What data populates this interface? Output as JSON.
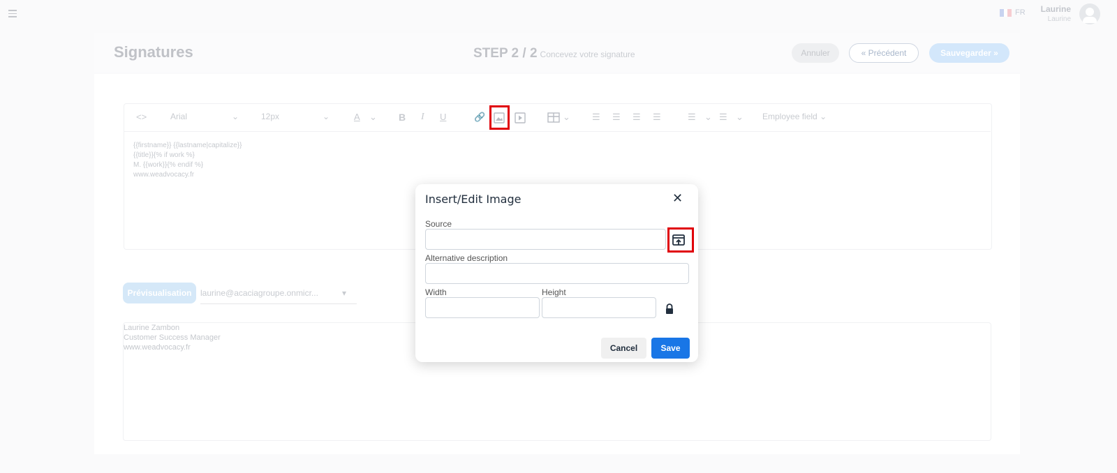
{
  "topbar": {
    "lang": "FR",
    "user_name": "Laurine",
    "user_sub": "Laurine"
  },
  "page": {
    "title": "Signatures",
    "step": "STEP 2 / 2",
    "step_sub": "Concevez votre signature",
    "btn_cancel": "Annuler",
    "btn_prev": "Précédent",
    "btn_save": "Sauvegarder"
  },
  "toolbar": {
    "font": "Arial",
    "size": "12px",
    "employee_field": "Employee field"
  },
  "editor_lines": [
    "{{firstname}} {{lastname|capitalize}}",
    "{{title}}{% if work %}",
    "M. {{work}}{% endif %}",
    "www.weadvocacy.fr"
  ],
  "preview": {
    "tab": "Prévisualisation",
    "email": "laurine@acaciagroupe.onmicr...",
    "lines": [
      "Laurine Zambon",
      "Customer Success Manager",
      "www.weadvocacy.fr"
    ]
  },
  "modal": {
    "title": "Insert/Edit Image",
    "source_label": "Source",
    "source_value": "",
    "alt_label": "Alternative description",
    "alt_value": "",
    "width_label": "Width",
    "width_value": "",
    "height_label": "Height",
    "height_value": "",
    "cancel": "Cancel",
    "save": "Save"
  }
}
